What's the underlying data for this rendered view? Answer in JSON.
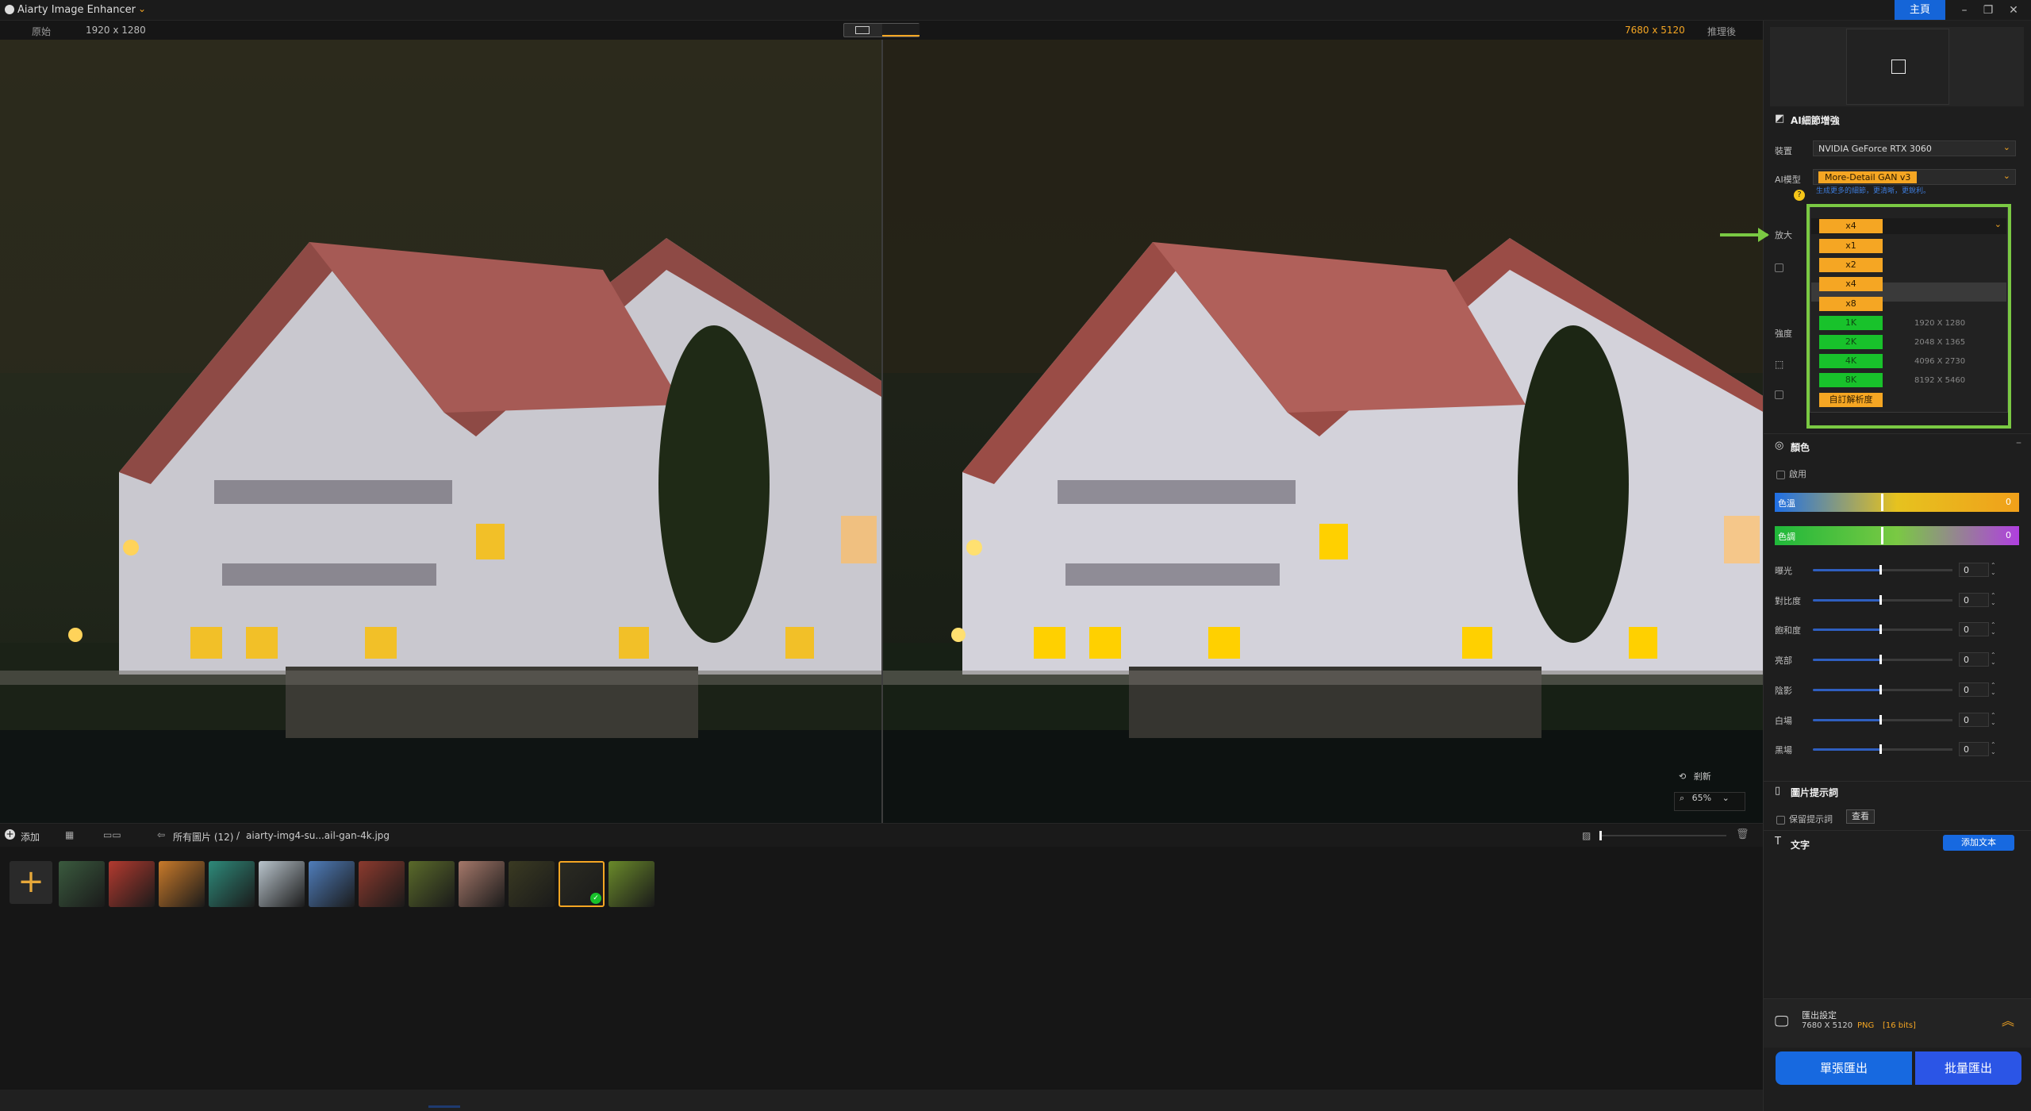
{
  "titlebar": {
    "app_title": "Aiarty Image Enhancer",
    "home_label": "主頁",
    "minimize": "–",
    "maximize": "❐",
    "close": "✕"
  },
  "infobar": {
    "left_label": "原始",
    "left_res": "1920 x 1280",
    "right_res": "7680 x 5120",
    "right_label": "推理後"
  },
  "viewer": {
    "rotate_label": "剎新",
    "zoom_value": "65%"
  },
  "thumbbar": {
    "add_label": "添加",
    "path_all": "所有圖片 (12)",
    "path_sep": "/",
    "filename": "aiarty-img4-su...ail-gan-4k.jpg"
  },
  "thumbnails": [
    "#3a5a3e",
    "#b33a2f",
    "#c97a2a",
    "#2e8a7a",
    "#b9c4cc",
    "#4f7dbb",
    "#8c3a2e",
    "#5a6a2a",
    "#a5786a",
    "#3a3a22",
    "#2b2b22",
    "#6a8a2a"
  ],
  "panel": {
    "ai_section": "AI細節增強",
    "device_label": "裝置",
    "device_value": "NVIDIA GeForce RTX 3060",
    "model_label": "AI模型",
    "model_value": "More-Detail GAN  v3",
    "model_hint": "生成更多的細節，更清晰，更銳利。",
    "scale_label": "放大",
    "strength_label": "強度",
    "color_section": "顏色",
    "enable_label": "啟用",
    "color_temp_label": "色溫",
    "color_temp_value": "0",
    "tint_label": "色調",
    "tint_value": "0",
    "adjustments": [
      {
        "label": "曝光",
        "value": "0"
      },
      {
        "label": "對比度",
        "value": "0"
      },
      {
        "label": "飽和度",
        "value": "0"
      },
      {
        "label": "亮部",
        "value": "0"
      },
      {
        "label": "陰影",
        "value": "0"
      },
      {
        "label": "白場",
        "value": "0"
      },
      {
        "label": "黑場",
        "value": "0"
      }
    ],
    "prompt_section": "圖片提示詞",
    "keep_prompt_label": "保留提示詞",
    "view_btn": "查看",
    "text_section": "文字",
    "add_text_btn": "添加文本",
    "export_title": "匯出設定",
    "export_res": "7680 X 5120",
    "export_format": "PNG",
    "export_bits": "[16 bits]",
    "export_single": "單張匯出",
    "export_batch": "批量匯出"
  },
  "scale_menu": {
    "current": "x4",
    "options": [
      {
        "label": "x1",
        "res": ""
      },
      {
        "label": "x2",
        "res": ""
      },
      {
        "label": "x4",
        "res": ""
      },
      {
        "label": "x8",
        "res": ""
      },
      {
        "label": "1K",
        "res": "1920 X 1280"
      },
      {
        "label": "2K",
        "res": "2048 X 1365"
      },
      {
        "label": "4K",
        "res": "4096 X 2730"
      },
      {
        "label": "8K",
        "res": "8192 X 5460"
      },
      {
        "label": "自訂解析度",
        "res": ""
      }
    ]
  }
}
